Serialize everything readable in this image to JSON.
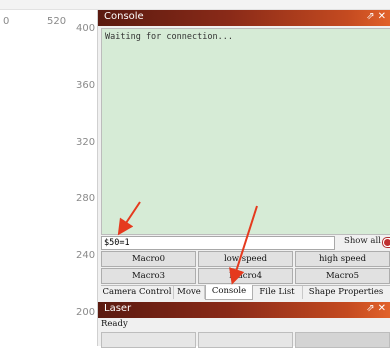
{
  "ruler": {
    "top_left": "0",
    "top_mid": "520",
    "ticks": [
      "400",
      "360",
      "320",
      "280",
      "240",
      "200"
    ]
  },
  "console": {
    "title": "Console",
    "pin_icon": "pin-icon",
    "close_icon": "close-icon",
    "output": "Waiting for connection...",
    "command_value": "$50=1",
    "show_all_label": "Show all"
  },
  "macros": {
    "row1": [
      "Macro0",
      "low speed",
      "high speed"
    ],
    "row2": [
      "Macro3",
      "Macro4",
      "Macro5"
    ]
  },
  "tabs": [
    "Camera Control",
    "Move",
    "Console",
    "File List",
    "Shape Properties"
  ],
  "active_tab": "Console",
  "laser": {
    "title": "Laser",
    "status": "Ready"
  },
  "colors": {
    "title_gradient_start": "#5a1a10",
    "title_gradient_end": "#e2622a",
    "console_bg": "#d6ebd6",
    "arrow": "#e53a1e"
  }
}
